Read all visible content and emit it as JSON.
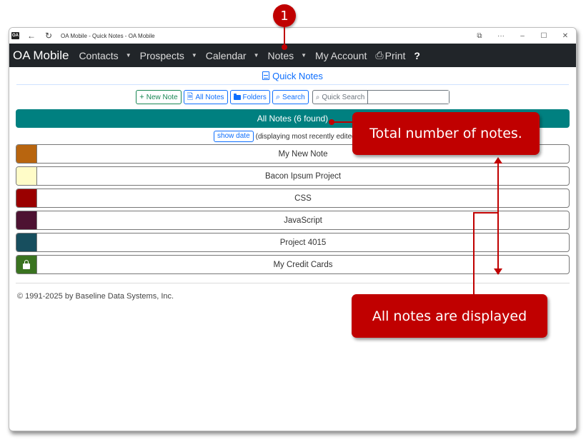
{
  "window": {
    "app_icon_label": "OA",
    "title": "OA Mobile - Quick Notes - OA Mobile",
    "controls": [
      "⧉",
      "···",
      "–",
      "☐",
      "✕"
    ]
  },
  "navbar": {
    "brand": "OA Mobile",
    "items": [
      {
        "label": "Contacts",
        "has_dropdown": true
      },
      {
        "label": "Prospects",
        "has_dropdown": true
      },
      {
        "label": "Calendar",
        "has_dropdown": true
      },
      {
        "label": "Notes",
        "has_dropdown": true
      },
      {
        "label": "My Account",
        "has_dropdown": false
      }
    ],
    "print_label": "Print",
    "help_label": "?"
  },
  "page": {
    "title": "Quick Notes",
    "toolbar": {
      "new_note": "New Note",
      "all_notes": "All Notes",
      "folders": "Folders",
      "search": "Search",
      "quick_search_label": "Quick Search",
      "quick_search_value": ""
    },
    "results_bar": "All Notes (6 found)",
    "show_date_button": "show date",
    "sort_hint": "(displaying most recently edited first)",
    "notes": [
      {
        "title": "My New Note",
        "color": "#b8650f",
        "locked": false
      },
      {
        "title": "Bacon Ipsum Project",
        "color": "#fffcc8",
        "locked": false
      },
      {
        "title": "CSS",
        "color": "#9a0000",
        "locked": false
      },
      {
        "title": "JavaScript",
        "color": "#4d1232",
        "locked": false
      },
      {
        "title": "Project 4015",
        "color": "#174e5e",
        "locked": false
      },
      {
        "title": "My Credit Cards",
        "color": "#3a7320",
        "locked": true
      }
    ],
    "footer": "© 1991-2025 by Baseline Data Systems, Inc."
  },
  "annotations": {
    "step_badge": "1",
    "callout_total": "Total number of notes.",
    "callout_all": "All notes are displayed",
    "accent_color": "#c00000"
  }
}
